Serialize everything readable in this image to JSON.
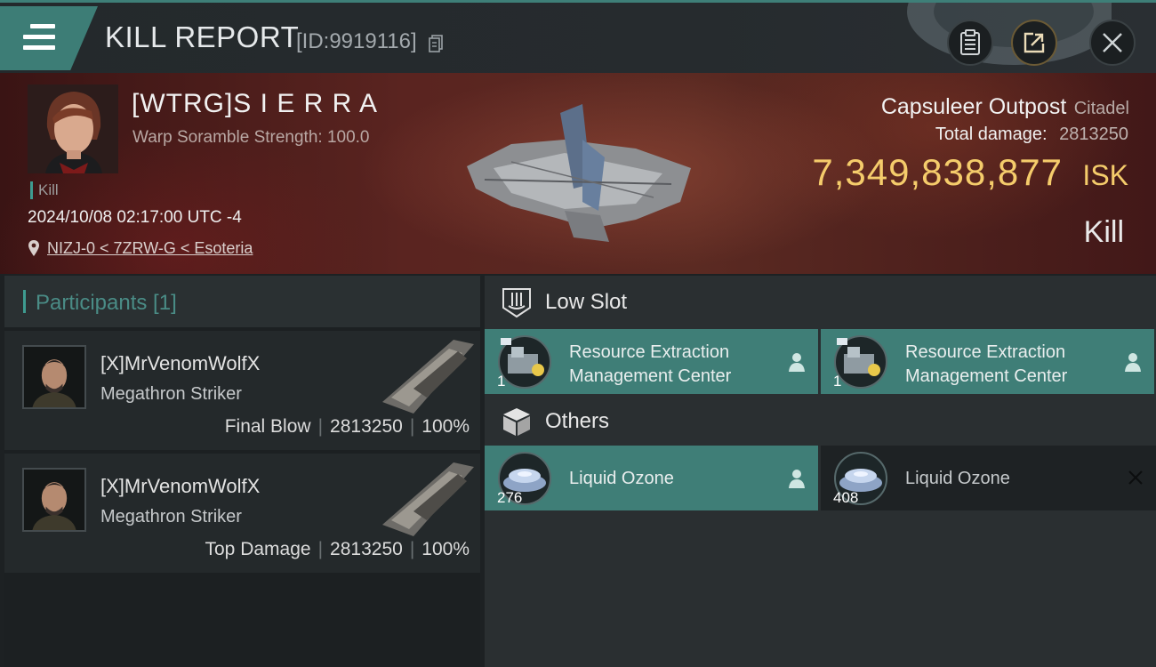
{
  "header": {
    "title": "KILL REPORT",
    "report_id": "[ID:9919116]"
  },
  "victim": {
    "name": "[WTRG]S I E R R A",
    "scramble": "Warp Soramble Strength: 100.0",
    "kill_tag": "Kill",
    "datetime": "2024/10/08 02:17:00 UTC -4",
    "location": "NIZJ-0 < 7ZRW-G < Esoteria"
  },
  "target": {
    "ship_name": "Capsuleer Outpost",
    "ship_class": "Citadel",
    "damage_label": "Total damage:",
    "damage_value": "2813250",
    "isk_value": "7,349,838,877",
    "isk_currency": "ISK",
    "result": "Kill"
  },
  "participants": {
    "label": "Participants [1]",
    "cards": [
      {
        "name": "[X]MrVenomWolfX",
        "ship": "Megathron Striker",
        "role": "Final Blow",
        "damage": "2813250",
        "percent": "100%"
      },
      {
        "name": "[X]MrVenomWolfX",
        "ship": "Megathron Striker",
        "role": "Top Damage",
        "damage": "2813250",
        "percent": "100%"
      }
    ]
  },
  "sections": {
    "low_slot": {
      "label": "Low Slot",
      "items": [
        {
          "name": "Resource Extraction Management Center",
          "qty": "1",
          "state": "dropped"
        },
        {
          "name": "Resource Extraction Management Center",
          "qty": "1",
          "state": "dropped"
        }
      ]
    },
    "others": {
      "label": "Others",
      "items": [
        {
          "name": "Liquid Ozone",
          "qty": "276",
          "state": "dropped"
        },
        {
          "name": "Liquid Ozone",
          "qty": "408",
          "state": "destroyed"
        }
      ]
    }
  },
  "icons": {
    "menu": "hamburger-icon",
    "copy": "copy-icon",
    "clipboard": "clipboard-icon",
    "share": "share-icon",
    "close": "close-icon",
    "location": "location-pin-icon",
    "low_slot": "low-slot-icon",
    "others": "cube-icon",
    "pilot": "pilot-icon",
    "destroyed": "x-icon"
  },
  "colors": {
    "accent": "#3f7e77",
    "isk": "#f5cc6b",
    "banner": "#5a2420"
  }
}
